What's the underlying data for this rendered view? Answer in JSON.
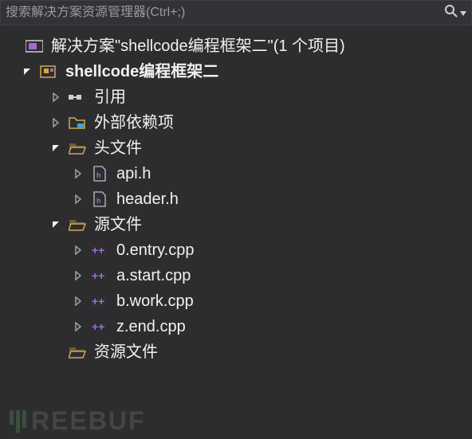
{
  "search": {
    "placeholder": "搜索解决方案资源管理器(Ctrl+;)"
  },
  "solution": {
    "label": "解决方案\"shellcode编程框架二\"(1 个项目)"
  },
  "project": {
    "label": "shellcode编程框架二"
  },
  "nodes": {
    "references": "引用",
    "external": "外部依赖项",
    "headers": "头文件",
    "api_h": "api.h",
    "header_h": "header.h",
    "sources": "源文件",
    "entry_cpp": "0.entry.cpp",
    "start_cpp": "a.start.cpp",
    "work_cpp": "b.work.cpp",
    "end_cpp": "z.end.cpp",
    "resources": "资源文件"
  },
  "watermark": "REEBUF"
}
